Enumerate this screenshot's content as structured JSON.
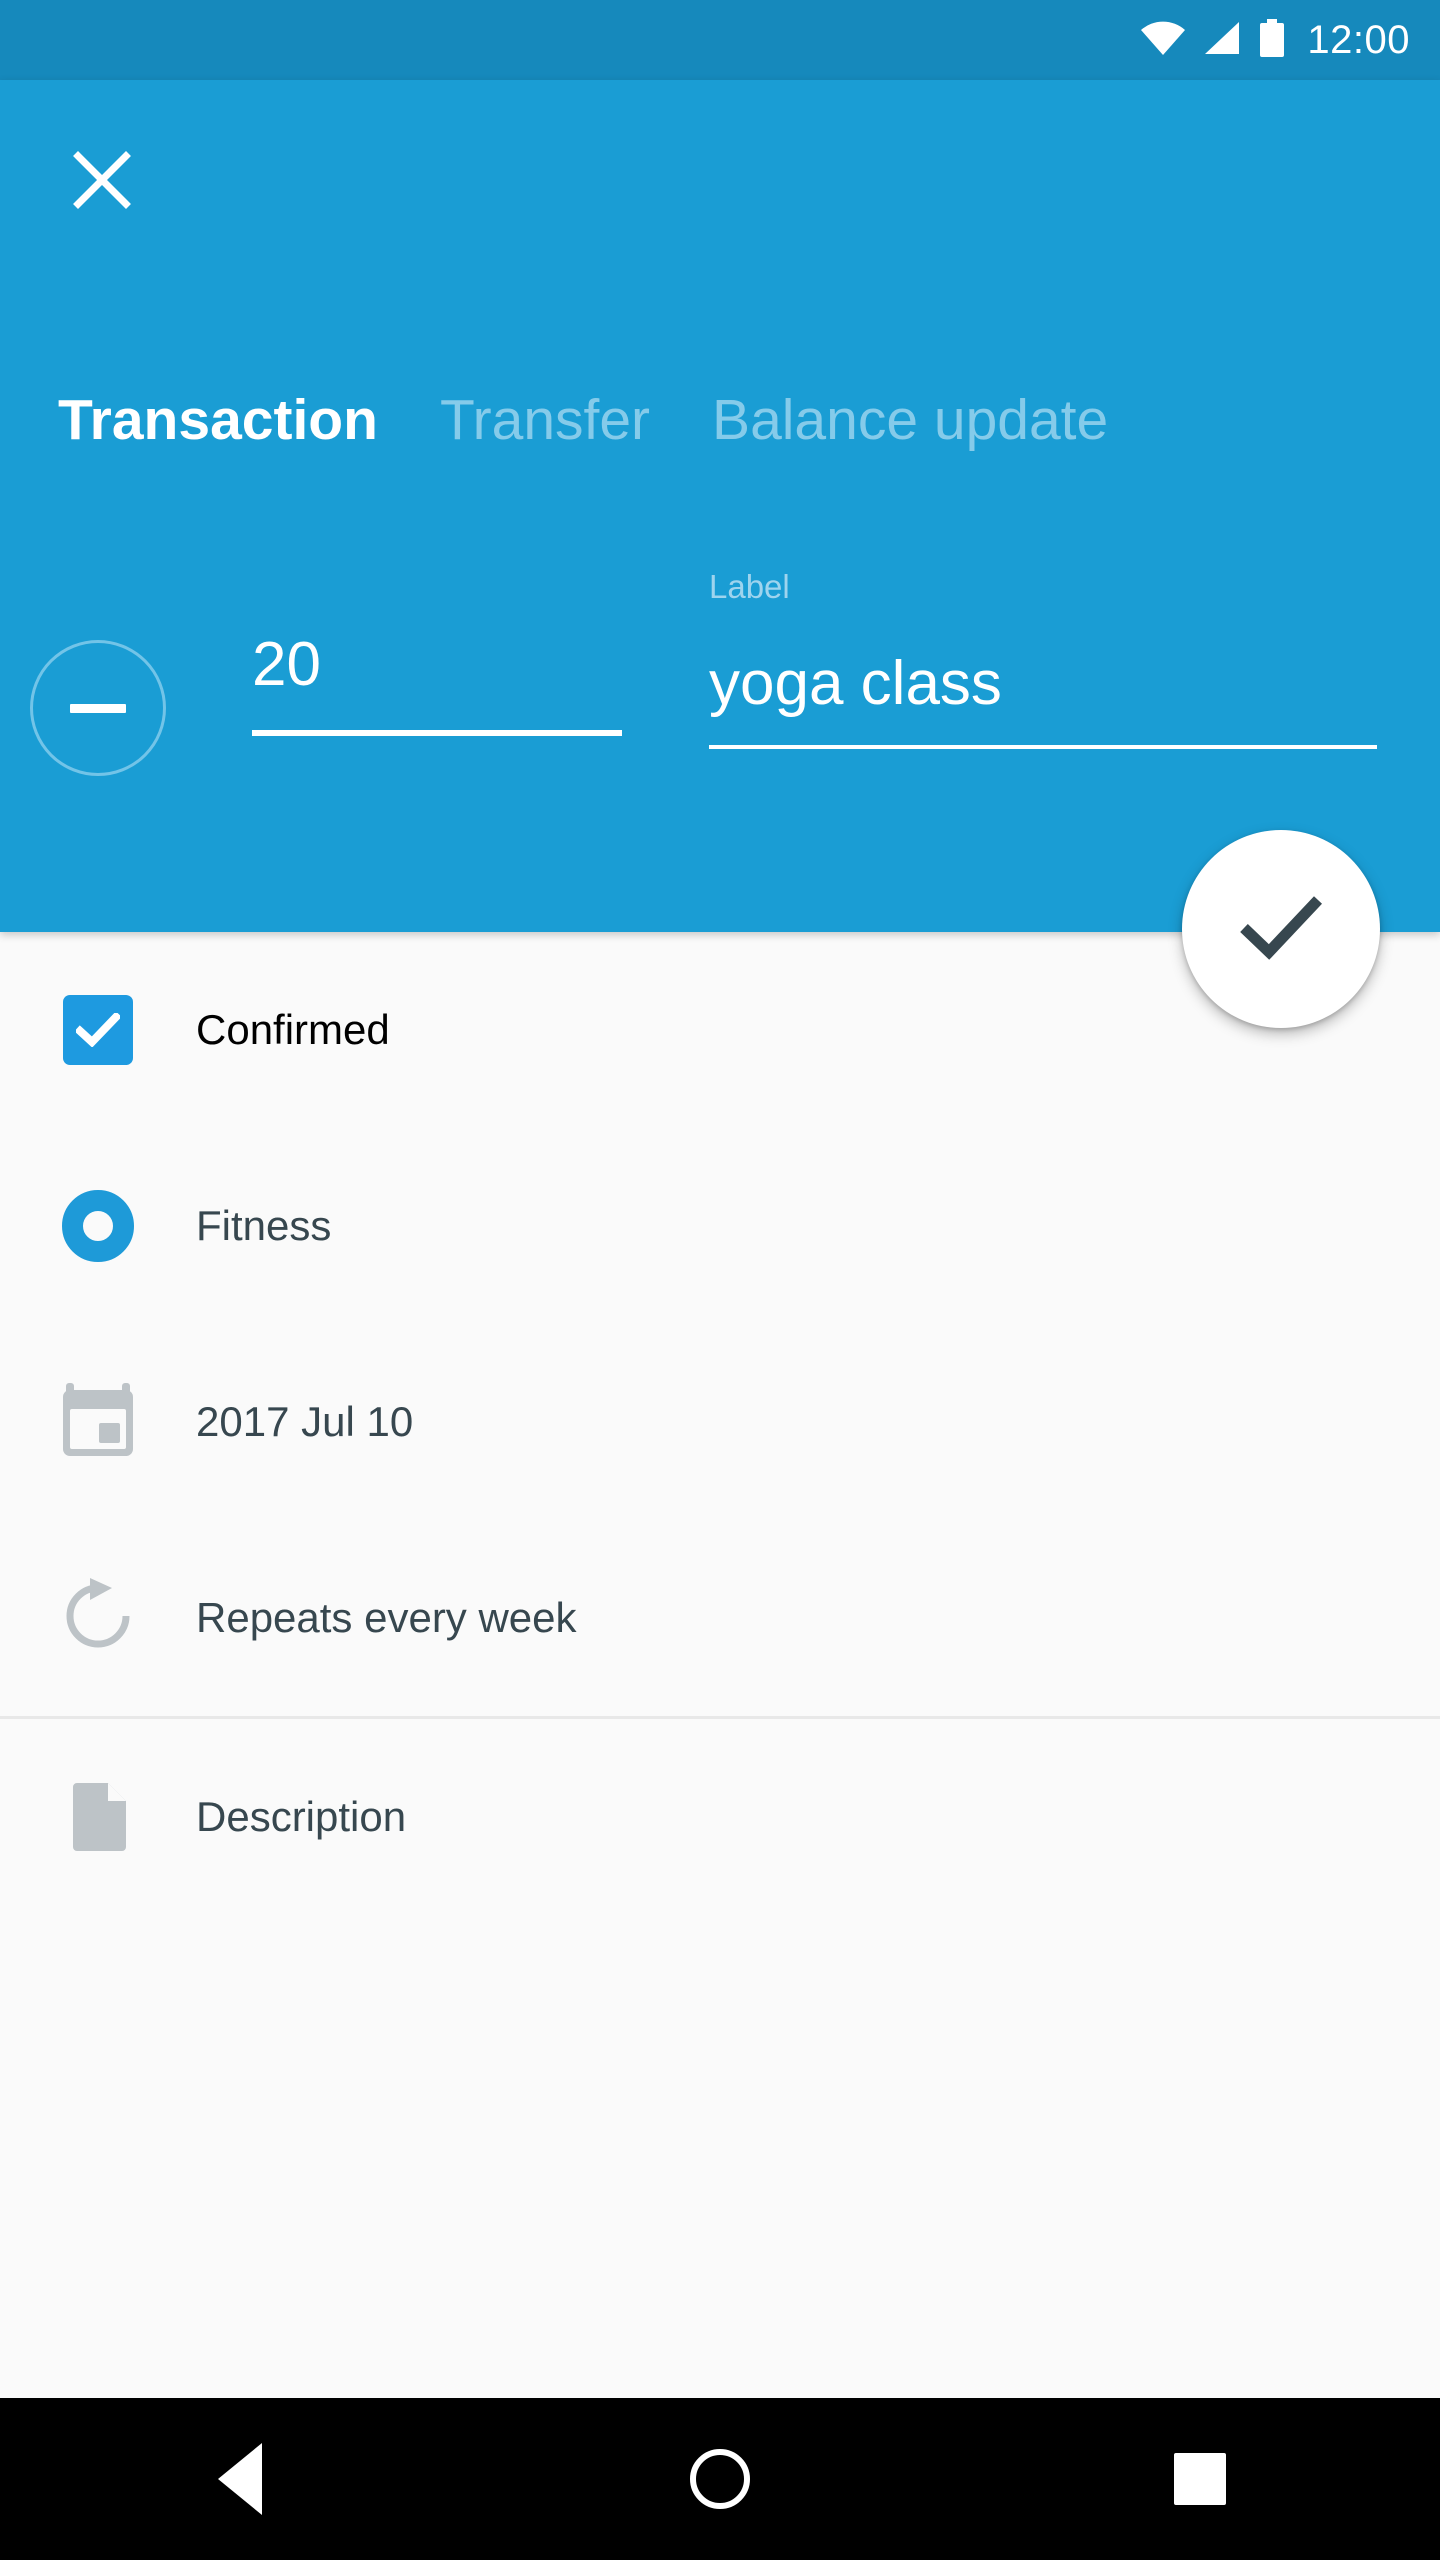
{
  "status_bar": {
    "time": "12:00",
    "icons": [
      "wifi-icon",
      "cell-signal-icon",
      "battery-icon"
    ]
  },
  "header": {
    "close_icon": "close-icon",
    "background_color": "#1a9dd4",
    "tabs": [
      {
        "label": "Transaction",
        "active": true
      },
      {
        "label": "Transfer",
        "active": false
      },
      {
        "label": "Balance update",
        "active": false
      }
    ],
    "amount": {
      "sign_toggle_icon": "minus-icon",
      "value": "20"
    },
    "label_field": {
      "hint": "Label",
      "value": "yoga class"
    },
    "confirm_fab": {
      "icon": "check-icon"
    }
  },
  "list": {
    "rows": [
      {
        "icon": "checkbox-checked-icon",
        "label": "Confirmed"
      },
      {
        "icon": "category-ring-icon",
        "label": "Fitness"
      },
      {
        "icon": "calendar-icon",
        "label": "2017 Jul 10"
      },
      {
        "icon": "repeat-icon",
        "label": "Repeats every week"
      },
      {
        "icon": "description-icon",
        "label": "Description"
      }
    ]
  },
  "nav_bar": {
    "back_label": "back-icon",
    "home_label": "home-icon",
    "recents_label": "recents-icon"
  },
  "colors": {
    "accent": "#1a9dd4",
    "status_bar": "#1689bc",
    "tab_inactive": "#85cbea",
    "surface": "#fafafa",
    "text_primary": "#37474f",
    "icon_gray": "#bdc3c7"
  }
}
